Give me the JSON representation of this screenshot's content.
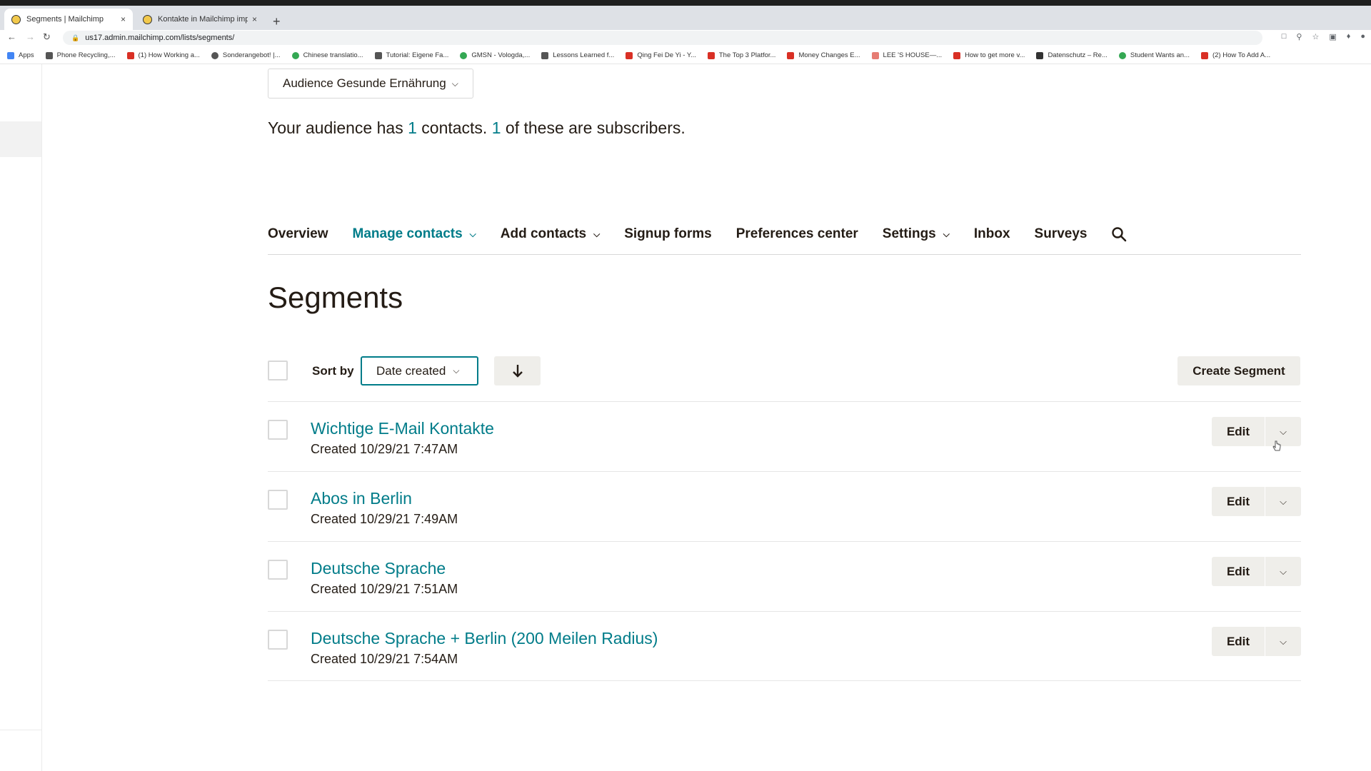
{
  "browser": {
    "tabs": [
      {
        "title": "Segments | Mailchimp",
        "close": "×"
      },
      {
        "title": "Kontakte in Mailchimp importi",
        "close": "×"
      }
    ],
    "new_tab": "+",
    "url": "us17.admin.mailchimp.com/lists/segments/",
    "bookmarks": [
      {
        "label": "Apps",
        "color": "#4285f4"
      },
      {
        "label": "Phone Recycling,...",
        "color": "#555555"
      },
      {
        "label": "(1) How Working a...",
        "color": "#d93025"
      },
      {
        "label": "Sonderangebot! |...",
        "color": "#555555"
      },
      {
        "label": "Chinese translatio...",
        "color": "#34a853"
      },
      {
        "label": "Tutorial: Eigene Fa...",
        "color": "#555555"
      },
      {
        "label": "GMSN - Vologda,...",
        "color": "#34a853"
      },
      {
        "label": "Lessons Learned f...",
        "color": "#555555"
      },
      {
        "label": "Qing Fei De Yi - Y...",
        "color": "#d93025"
      },
      {
        "label": "The Top 3 Platfor...",
        "color": "#d93025"
      },
      {
        "label": "Money Changes E...",
        "color": "#d93025"
      },
      {
        "label": "LEE 'S HOUSE—...",
        "color": "#e67c73"
      },
      {
        "label": "How to get more v...",
        "color": "#d93025"
      },
      {
        "label": "Datenschutz – Re...",
        "color": "#333333"
      },
      {
        "label": "Student Wants an...",
        "color": "#34a853"
      },
      {
        "label": "(2) How To Add A...",
        "color": "#d93025"
      }
    ]
  },
  "audience_select": {
    "label": "Audience Gesunde Ernährung"
  },
  "summary": {
    "prefix": "Your audience has ",
    "contacts": "1",
    "middle": " contacts. ",
    "subscribers": "1",
    "suffix": " of these are subscribers."
  },
  "nav": {
    "overview": "Overview",
    "manage_contacts": "Manage contacts",
    "add_contacts": "Add contacts",
    "signup_forms": "Signup forms",
    "preferences_center": "Preferences center",
    "settings": "Settings",
    "inbox": "Inbox",
    "surveys": "Surveys"
  },
  "page_title": "Segments",
  "toolbar": {
    "sort_label": "Sort by",
    "sort_value": "Date created",
    "create_label": "Create Segment"
  },
  "segments": [
    {
      "name": "Wichtige E-Mail Kontakte",
      "created": "Created 10/29/21 7:47AM",
      "edit": "Edit"
    },
    {
      "name": "Abos in Berlin",
      "created": "Created 10/29/21 7:49AM",
      "edit": "Edit"
    },
    {
      "name": "Deutsche Sprache",
      "created": "Created 10/29/21 7:51AM",
      "edit": "Edit"
    },
    {
      "name": "Deutsche Sprache + Berlin (200 Meilen Radius)",
      "created": "Created 10/29/21 7:54AM",
      "edit": "Edit"
    }
  ],
  "colors": {
    "accent": "#007c89",
    "text": "#241c15",
    "button_bg": "#efeeea"
  }
}
